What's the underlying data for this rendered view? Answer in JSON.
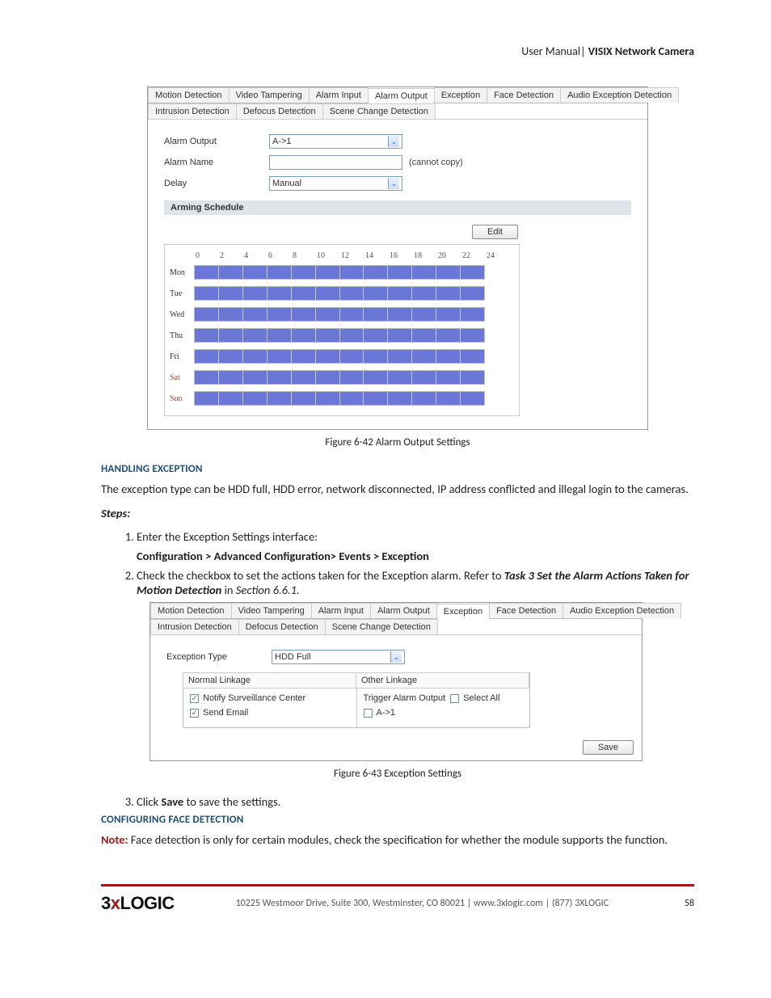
{
  "header": {
    "left": "User Manual",
    "right": "VISIX Network Camera"
  },
  "shot1": {
    "tabs_row1": [
      "Motion Detection",
      "Video Tampering",
      "Alarm Input",
      "Alarm Output",
      "Exception",
      "Face Detection",
      "Audio Exception Detection"
    ],
    "tabs_row2": [
      "Intrusion Detection",
      "Defocus Detection",
      "Scene Change Detection"
    ],
    "active_tab": "Alarm Output",
    "form": {
      "alarm_output_label": "Alarm Output",
      "alarm_output_value": "A->1",
      "alarm_name_label": "Alarm Name",
      "alarm_name_value": "",
      "alarm_name_note": "(cannot copy)",
      "delay_label": "Delay",
      "delay_value": "Manual"
    },
    "arming_header": "Arming Schedule",
    "edit_btn": "Edit",
    "hours": [
      "0",
      "2",
      "4",
      "6",
      "8",
      "10",
      "12",
      "14",
      "16",
      "18",
      "20",
      "22",
      "24"
    ],
    "days": [
      "Mon",
      "Tue",
      "Wed",
      "Thu",
      "Fri",
      "Sat",
      "Sun"
    ]
  },
  "caption1": "Figure 6-42 Alarm Output Settings",
  "section1_title": "HANDLING EXCEPTION",
  "section1_text": "The exception type can be HDD full, HDD error, network disconnected, IP address conflicted and illegal login to the cameras.",
  "steps_label": "Steps:",
  "step1_a": "Enter the Exception Settings interface:",
  "step1_b": "Configuration > Advanced Configuration> Events > Exception",
  "step2_a": "Check the checkbox to set the actions taken for the Exception alarm. Refer to ",
  "step2_b": "Task 3 Set the Alarm Actions Taken for Motion Detection",
  "step2_c": " in ",
  "step2_d": "Section 6.6.1.",
  "shot2": {
    "tabs_row1": [
      "Motion Detection",
      "Video Tampering",
      "Alarm Input",
      "Alarm Output",
      "Exception",
      "Face Detection",
      "Audio Exception Detection"
    ],
    "tabs_row2": [
      "Intrusion Detection",
      "Defocus Detection",
      "Scene Change Detection"
    ],
    "active_tab": "Exception",
    "exception_type_label": "Exception Type",
    "exception_type_value": "HDD Full",
    "normal_linkage": "Normal Linkage",
    "other_linkage": "Other Linkage",
    "notify": "Notify Surveillance Center",
    "send_email": "Send Email",
    "trigger": "Trigger Alarm Output",
    "select_all": "Select All",
    "a1": "A->1",
    "save": "Save"
  },
  "caption2": "Figure 6-43 Exception Settings",
  "step3_a": "Click ",
  "step3_b": "Save",
  "step3_c": " to save the settings.",
  "section2_title": "CONFIGURING FACE DETECTION",
  "note_label": "Note:",
  "note_text": " Face detection is only for certain modules, check the specification for whether the module supports the function.",
  "footer": {
    "address": "10225 Westmoor Drive, Suite 300, Westminster, CO 80021  |  www.3xlogic.com  |  (877) 3XLOGIC",
    "page": "58"
  }
}
